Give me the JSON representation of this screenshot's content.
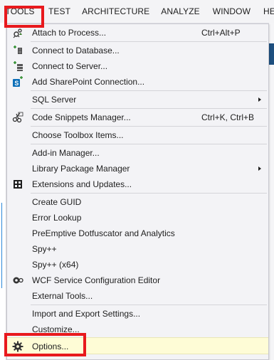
{
  "menubar": {
    "items": [
      "TOOLS",
      "TEST",
      "ARCHITECTURE",
      "ANALYZE",
      "WINDOW",
      "HEL"
    ]
  },
  "menu": {
    "attach": {
      "label": "Attach to Process...",
      "shortcut": "Ctrl+Alt+P",
      "icon": "attach-process-icon"
    },
    "connect_db": {
      "label": "Connect to Database...",
      "icon": "database-connect-icon"
    },
    "connect_server": {
      "label": "Connect to Server...",
      "icon": "server-connect-icon"
    },
    "sharepoint": {
      "label": "Add SharePoint Connection...",
      "icon": "sharepoint-icon"
    },
    "sql_server": {
      "label": "SQL Server"
    },
    "snippets": {
      "label": "Code Snippets Manager...",
      "shortcut": "Ctrl+K, Ctrl+B",
      "icon": "snippets-icon"
    },
    "toolbox": {
      "label": "Choose Toolbox Items..."
    },
    "addin": {
      "label": "Add-in Manager..."
    },
    "library_pkg": {
      "label": "Library Package Manager"
    },
    "extensions": {
      "label": "Extensions and Updates...",
      "icon": "extensions-icon"
    },
    "guid": {
      "label": "Create GUID"
    },
    "error_lookup": {
      "label": "Error Lookup"
    },
    "dotfuscator": {
      "label": "PreEmptive Dotfuscator and Analytics"
    },
    "spy": {
      "label": "Spy++"
    },
    "spy64": {
      "label": "Spy++ (x64)"
    },
    "wcf": {
      "label": "WCF Service Configuration Editor",
      "icon": "wcf-config-icon"
    },
    "external": {
      "label": "External Tools..."
    },
    "import_export": {
      "label": "Import and Export Settings..."
    },
    "customize": {
      "label": "Customize..."
    },
    "options": {
      "label": "Options...",
      "icon": "gear-icon"
    }
  },
  "colors": {
    "highlight_border": "#e8191d",
    "menu_background": "#f3f3f6",
    "hover_background": "#fefcd6"
  }
}
